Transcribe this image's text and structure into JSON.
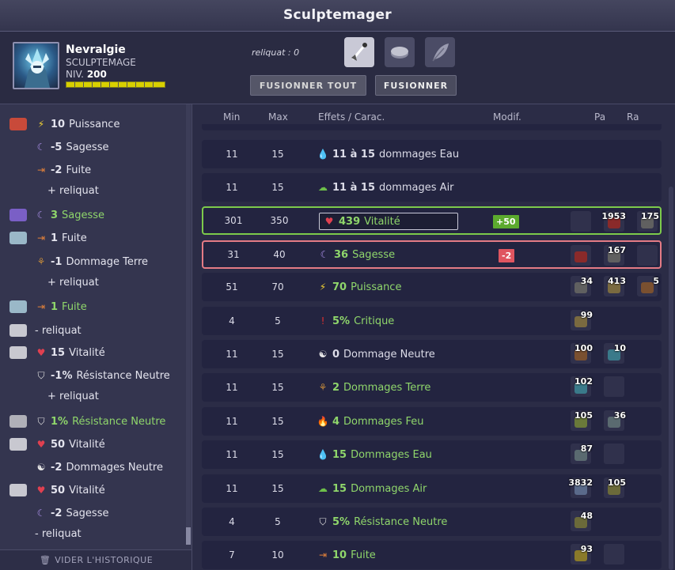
{
  "window": {
    "title": "Sculptemager"
  },
  "character": {
    "name": "Nevralgie",
    "class": "SCULPTEMAGE",
    "level_label": "NIV.",
    "level": "200"
  },
  "header": {
    "reliquat": "reliquat : 0",
    "fusion_all_label": "FUSIONNER TOUT",
    "fusion_label": "FUSIONNER"
  },
  "slots": [
    "weapon-icon",
    "ring-icon",
    "feather-icon"
  ],
  "history": [
    {
      "value": "10",
      "text": "Puissance",
      "icon": "bolt-icon"
    },
    {
      "value": "-5",
      "text": "Sagesse",
      "icon": "moon-icon"
    },
    {
      "value": "-2",
      "text": "Fuite",
      "icon": "door-icon"
    },
    {
      "text": "+ reliquat"
    },
    {
      "value": "3",
      "text": "Sagesse",
      "icon": "moon-icon",
      "green": true
    },
    {
      "value": "1",
      "text": "Fuite",
      "icon": "door-icon"
    },
    {
      "value": "-1",
      "text": "Dommage Terre",
      "icon": "earth-icon"
    },
    {
      "text": "+ reliquat"
    },
    {
      "value": "1",
      "text": "Fuite",
      "icon": "door-icon",
      "green": true
    },
    {
      "text": "- reliquat"
    },
    {
      "value": "15",
      "text": "Vitalité",
      "icon": "heart-icon"
    },
    {
      "value": "-1%",
      "text": "Résistance Neutre",
      "icon": "shield-icon"
    },
    {
      "text": "+ reliquat"
    },
    {
      "value": "1%",
      "text": "Résistance Neutre",
      "icon": "shield-icon",
      "green": true
    },
    {
      "value": "50",
      "text": "Vitalité",
      "icon": "heart-icon"
    },
    {
      "value": "-2",
      "text": "Dommages Neutre",
      "icon": "yinyang-icon"
    },
    {
      "value": "50",
      "text": "Vitalité",
      "icon": "heart-icon"
    },
    {
      "value": "-2",
      "text": "Sagesse",
      "icon": "moon-icon"
    },
    {
      "text": "- reliquat"
    }
  ],
  "clear_history": "VIDER L'HISTORIQUE",
  "table": {
    "headers": {
      "min": "Min",
      "max": "Max",
      "effects": "Effets / Carac.",
      "modif": "Modif.",
      "pa": "Pa",
      "ra": "Ra"
    },
    "rows": [
      {
        "min": "11",
        "max": "15",
        "value": "11 à 15",
        "text": "dommages Eau",
        "icon": "water-icon",
        "state": "normal",
        "runes": []
      },
      {
        "min": "11",
        "max": "15",
        "value": "11 à 15",
        "text": "dommages Air",
        "icon": "air-icon",
        "state": "normal",
        "runes": []
      },
      {
        "min": "301",
        "max": "350",
        "value": "439",
        "text": "Vitalité",
        "icon": "heart-icon",
        "state": "selected",
        "modif": "+50",
        "runes": [
          "",
          "1953",
          "175"
        ]
      },
      {
        "min": "31",
        "max": "40",
        "value": "36",
        "text": "Sagesse",
        "icon": "moon-icon",
        "state": "exceed",
        "modif": "-2",
        "runes": [
          "",
          "167",
          ""
        ]
      },
      {
        "min": "51",
        "max": "70",
        "value": "70",
        "text": "Puissance",
        "icon": "bolt-icon",
        "state": "normal",
        "runes": [
          "34",
          "413",
          "5"
        ]
      },
      {
        "min": "4",
        "max": "5",
        "value": "5%",
        "text": "Critique",
        "icon": "crit-icon",
        "state": "normal",
        "runes": [
          "99"
        ]
      },
      {
        "min": "11",
        "max": "15",
        "value": "0",
        "text": "Dommage Neutre",
        "icon": "yinyang-icon",
        "state": "neutral",
        "runes": [
          "100",
          "10"
        ]
      },
      {
        "min": "11",
        "max": "15",
        "value": "2",
        "text": "Dommages Terre",
        "icon": "earth-icon",
        "state": "normal",
        "runes": [
          "102",
          ""
        ]
      },
      {
        "min": "11",
        "max": "15",
        "value": "4",
        "text": "Dommages Feu",
        "icon": "fire-icon",
        "state": "normal",
        "runes": [
          "105",
          "36"
        ]
      },
      {
        "min": "11",
        "max": "15",
        "value": "15",
        "text": "Dommages Eau",
        "icon": "water-icon",
        "state": "normal",
        "runes": [
          "87",
          ""
        ]
      },
      {
        "min": "11",
        "max": "15",
        "value": "15",
        "text": "Dommages Air",
        "icon": "air-icon",
        "state": "normal",
        "runes": [
          "3832",
          "105"
        ]
      },
      {
        "min": "4",
        "max": "5",
        "value": "5%",
        "text": "Résistance Neutre",
        "icon": "shield-icon",
        "state": "normal",
        "runes": [
          "48"
        ]
      },
      {
        "min": "7",
        "max": "10",
        "value": "10",
        "text": "Fuite",
        "icon": "door-icon",
        "state": "normal",
        "runes": [
          "93",
          ""
        ]
      }
    ]
  },
  "colors": {
    "positive": "#8fd66b",
    "negative": "#e05560",
    "selected_border": "#7dcb4b",
    "exceed_border": "#e47b85"
  }
}
